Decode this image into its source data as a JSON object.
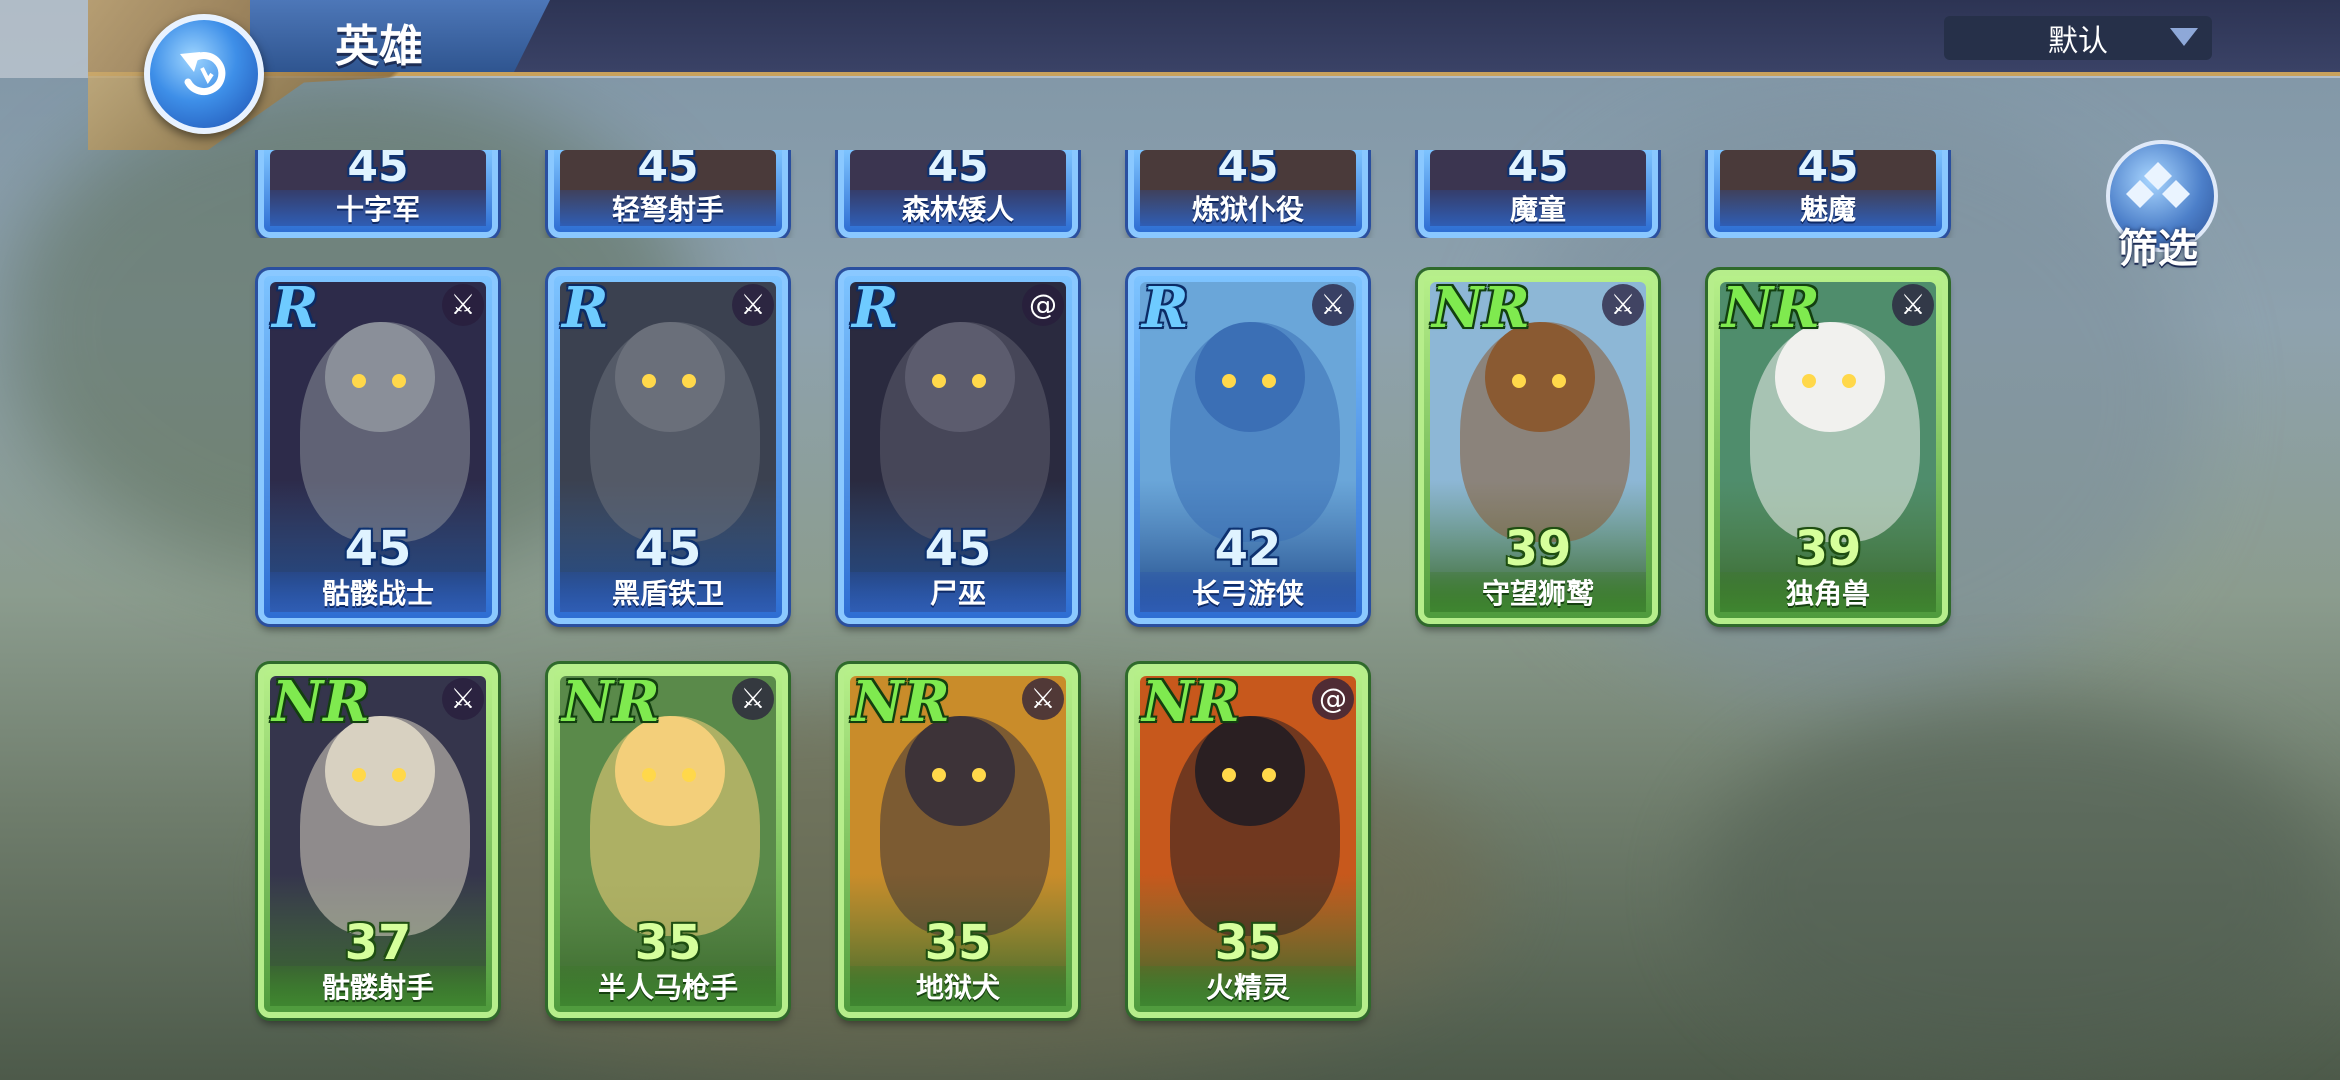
{
  "header": {
    "title": "英雄",
    "sort_value": "默认",
    "filter_label": "筛选"
  },
  "top_row": [
    {
      "level": "45",
      "name": "十字军"
    },
    {
      "level": "45",
      "name": "轻弩射手"
    },
    {
      "level": "45",
      "name": "森林矮人"
    },
    {
      "level": "45",
      "name": "炼狱仆役"
    },
    {
      "level": "45",
      "name": "魔童"
    },
    {
      "level": "45",
      "name": "魅魔"
    }
  ],
  "heroes": [
    {
      "rarity": "R",
      "level": "45",
      "name": "骷髅战士",
      "class_icon": "crossed-swords-icon",
      "art_color": "#2d2b4a",
      "accent": "#8a8f99"
    },
    {
      "rarity": "R",
      "level": "45",
      "name": "黑盾铁卫",
      "class_icon": "crossed-swords-icon",
      "art_color": "#3b4150",
      "accent": "#6a6f7a"
    },
    {
      "rarity": "R",
      "level": "45",
      "name": "尸巫",
      "class_icon": "magic-swirl-icon",
      "art_color": "#2a2a3f",
      "accent": "#5c5c6e"
    },
    {
      "rarity": "R",
      "level": "42",
      "name": "长弓游侠",
      "class_icon": "crossed-swords-icon",
      "art_color": "#6aa6d9",
      "accent": "#3b6fb5"
    },
    {
      "rarity": "NR",
      "level": "39",
      "name": "守望狮鹫",
      "class_icon": "crossed-swords-icon",
      "art_color": "#8db7d6",
      "accent": "#8a5a32"
    },
    {
      "rarity": "NR",
      "level": "39",
      "name": "独角兽",
      "class_icon": "crossed-swords-icon",
      "art_color": "#4f8d6c",
      "accent": "#f1f1ee"
    },
    {
      "rarity": "NR",
      "level": "37",
      "name": "骷髅射手",
      "class_icon": "crossed-swords-icon",
      "art_color": "#35354c",
      "accent": "#d8d1c1"
    },
    {
      "rarity": "NR",
      "level": "35",
      "name": "半人马枪手",
      "class_icon": "crossed-swords-icon",
      "art_color": "#5a8a4a",
      "accent": "#f3cf7a"
    },
    {
      "rarity": "NR",
      "level": "35",
      "name": "地狱犬",
      "class_icon": "crossed-swords-icon",
      "art_color": "#c98c2a",
      "accent": "#3d3338"
    },
    {
      "rarity": "NR",
      "level": "35",
      "name": "火精灵",
      "class_icon": "magic-swirl-icon",
      "art_color": "#c7581c",
      "accent": "#2a1f22"
    }
  ],
  "colors": {
    "r_accent": "#6ecbff",
    "nr_accent": "#7fea4f"
  }
}
